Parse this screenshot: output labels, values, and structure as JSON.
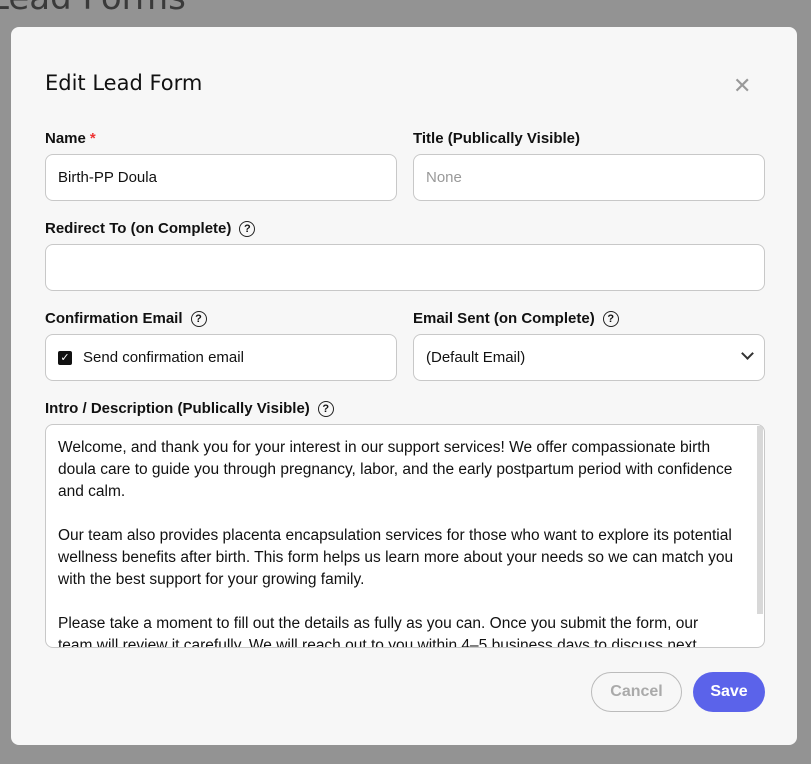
{
  "background": {
    "page_title": "Lead Forms"
  },
  "modal": {
    "title": "Edit Lead Form",
    "name": {
      "label": "Name",
      "required_mark": "*",
      "value": "Birth-PP Doula"
    },
    "title_field": {
      "label": "Title (Publically Visible)",
      "placeholder": "None"
    },
    "redirect": {
      "label": "Redirect To (on Complete)",
      "value": ""
    },
    "confirmation": {
      "label": "Confirmation Email",
      "checkbox_label": "Send confirmation email",
      "checked": true
    },
    "email_sent": {
      "label": "Email Sent (on Complete)",
      "selected": "(Default Email)"
    },
    "intro": {
      "label": "Intro / Description (Publically Visible)",
      "paragraphs": [
        "Welcome, and thank you for your interest in our support services! We offer compassionate birth doula care to guide you through pregnancy, labor, and the early postpartum period with confidence and calm.",
        "Our team also provides placenta encapsulation services for those who want to explore its potential wellness benefits after birth. This form helps us learn more about your needs so we can match you with the best support for your growing family.",
        "Please take a moment to fill out the details as fully as you can. Once you submit the form, our team will review it carefully. We will reach out to you within 4–5 business days to discuss next"
      ]
    },
    "cancel_label": "Cancel",
    "save_label": "Save",
    "accent": "#5b63ea"
  }
}
